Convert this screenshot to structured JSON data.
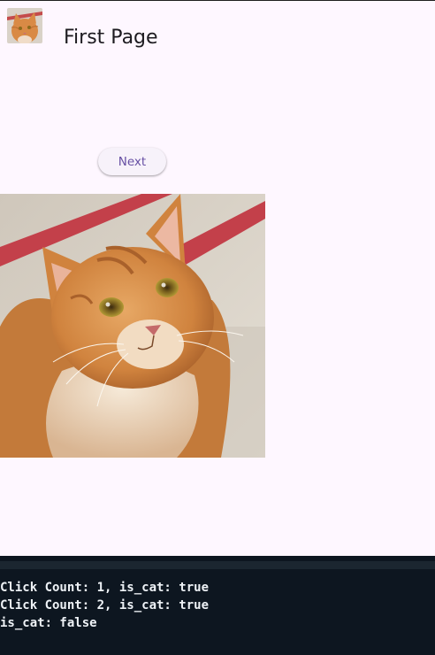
{
  "app_bar": {
    "title": "First Page",
    "avatar_icon": "cat-thumbnail-image"
  },
  "main": {
    "next_label": "Next",
    "photo_icon": "orange-tabby-cat-photo"
  },
  "console": {
    "lines": [
      "Click Count: 1, is_cat: true",
      "Click Count: 2, is_cat: true",
      "is_cat: false"
    ]
  },
  "colors": {
    "background": "#fef7ff",
    "accent": "#6750a4",
    "console_bg": "#0d1620"
  }
}
